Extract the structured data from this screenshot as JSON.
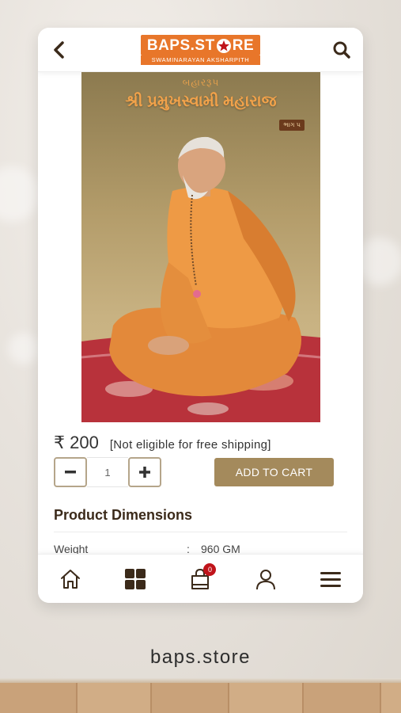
{
  "header": {
    "logo_main": "BAPS.ST",
    "logo_main_end": "RE",
    "logo_sub": "SWAMINARAYAN AKSHARPITH"
  },
  "product": {
    "cover_subtitle": "બહારરૂપ",
    "cover_title": "શ્રી પ્રમુખસ્વામી મહારાજ",
    "cover_part": "ભાગ ૫",
    "price": "₹ 200",
    "shipping_note": "[Not eligible for free shipping]",
    "quantity": "1",
    "add_to_cart_label": "ADD TO CART"
  },
  "dimensions": {
    "title": "Product Dimensions",
    "rows": [
      {
        "key": "Weight",
        "value": "960 GM"
      }
    ]
  },
  "bottom_nav": {
    "cart_count": "0"
  },
  "footer": {
    "url": "baps.store"
  },
  "colors": {
    "brand_orange": "#e8762a",
    "accent_gold": "#a48a5c",
    "badge_red": "#c0141b"
  }
}
